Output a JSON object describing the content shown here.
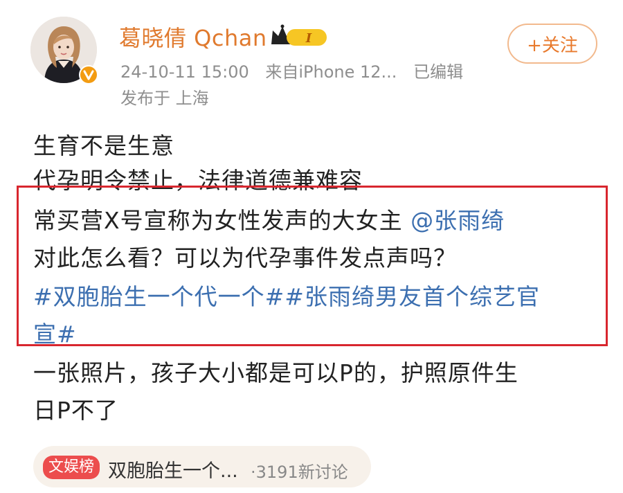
{
  "post": {
    "author": {
      "name": "葛晓倩 Qchan",
      "level_badge": "I"
    },
    "meta": {
      "timestamp": "24-10-11 15:00",
      "source": "来自iPhone 12...",
      "edited": "已编辑",
      "location": "发布于 上海"
    },
    "follow_label": "+关注",
    "lines": {
      "l1": "生育不是生意",
      "l2": "代孕明令禁止，法律道德兼难容",
      "l3_text": "常买营X号宣称为女性发声的大女主 ",
      "l3_mention": "@张雨绮",
      "l4": "对此怎么看？可以为代孕事件发点声吗？",
      "l5": "#双胞胎生一个代一个##张雨绮男友首个综艺官",
      "l6": "宣#",
      "l7": "一张照片，孩子大小都是可以P的，护照原件生",
      "l8": "日P不了"
    },
    "topic": {
      "badge": "文娱榜",
      "title": "双胞胎生一个...",
      "count": "·3191新讨论"
    }
  },
  "colors": {
    "username": "#e07a2e",
    "link": "#3c6fb0",
    "highlight_border": "#d8262e",
    "follow_border": "#f2b98d"
  },
  "icons": {
    "verify": "verified-v-icon",
    "crown": "crown-level-icon"
  }
}
